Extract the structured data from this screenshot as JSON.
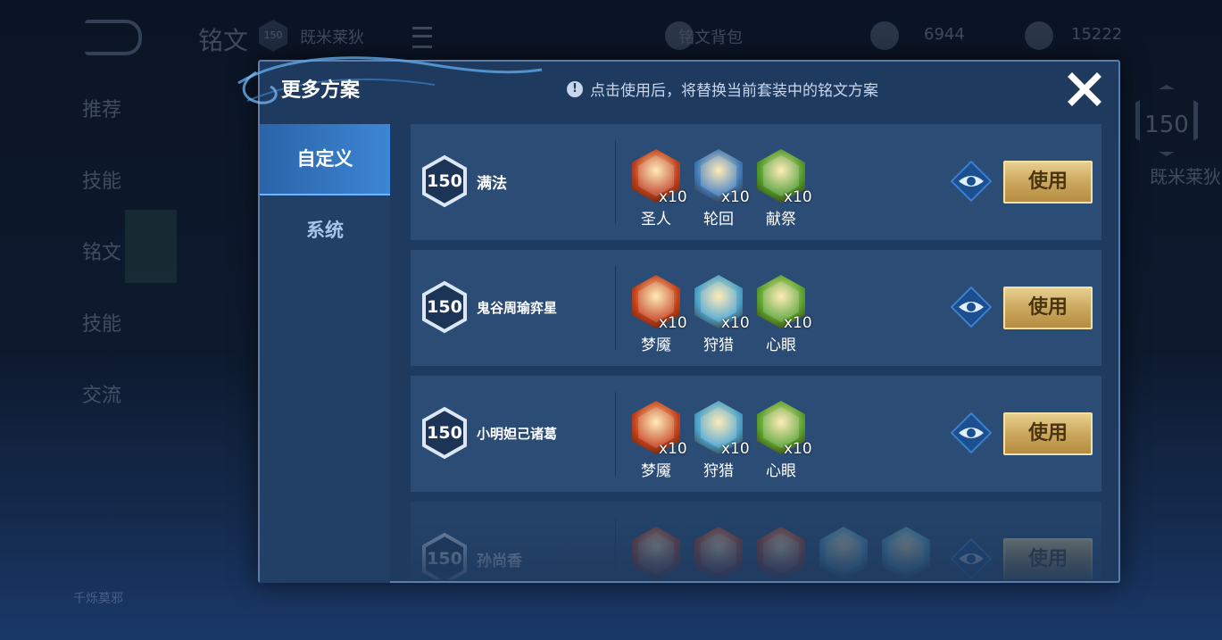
{
  "background": {
    "title": "铭文",
    "level": "150",
    "plan_name": "既米莱狄",
    "rune_label": "铭文背包",
    "currency1": "6944",
    "currency2": "15222",
    "side_items": [
      "推荐",
      "技能",
      "铭文",
      "技能",
      "交流"
    ],
    "right_level": "150",
    "right_name": "既米莱狄",
    "hero_name": "千烁莫邪"
  },
  "modal": {
    "title": "更多方案",
    "notice": "点击使用后，将替换当前套装中的铭文方案",
    "notice_icon": "!",
    "tabs": [
      {
        "label": "自定义",
        "active": true
      },
      {
        "label": "系统",
        "active": false
      }
    ],
    "use_label": "使用",
    "plans": [
      {
        "level": "150",
        "name": "满法",
        "runes": [
          {
            "name": "圣人",
            "count": "x10",
            "color": "#c0401e"
          },
          {
            "name": "轮回",
            "count": "x10",
            "color": "#3f7ab8"
          },
          {
            "name": "献祭",
            "count": "x10",
            "color": "#4f9a2c"
          }
        ]
      },
      {
        "level": "150",
        "name": "鬼谷周瑜弈星",
        "runes": [
          {
            "name": "梦魇",
            "count": "x10",
            "color": "#c5401a"
          },
          {
            "name": "狩猎",
            "count": "x10",
            "color": "#4aa1c9"
          },
          {
            "name": "心眼",
            "count": "x10",
            "color": "#5aa22e"
          }
        ]
      },
      {
        "level": "150",
        "name": "小明妲己诸葛",
        "runes": [
          {
            "name": "梦魇",
            "count": "x10",
            "color": "#c5401a"
          },
          {
            "name": "狩猎",
            "count": "x10",
            "color": "#4aa1c9"
          },
          {
            "name": "心眼",
            "count": "x10",
            "color": "#5aa22e"
          }
        ]
      },
      {
        "level": "150",
        "name": "孙尚香",
        "runes": [
          {
            "name": "",
            "count": "",
            "color": "#b83e22"
          },
          {
            "name": "",
            "count": "",
            "color": "#b83e22"
          },
          {
            "name": "",
            "count": "",
            "color": "#b83e22"
          },
          {
            "name": "",
            "count": "",
            "color": "#4aa1c9"
          },
          {
            "name": "",
            "count": "",
            "color": "#4aa1c9"
          }
        ]
      }
    ]
  }
}
